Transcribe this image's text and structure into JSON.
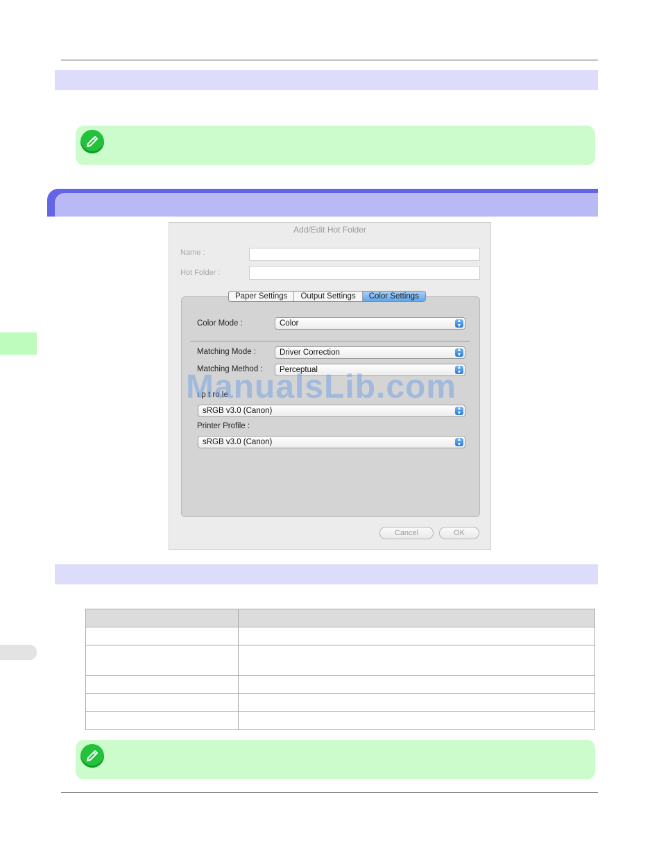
{
  "dialog": {
    "title": "Add/Edit Hot Folder",
    "name_label": "Name :",
    "name_value": "",
    "hot_folder_label": "Hot Folder :",
    "hot_folder_value": "",
    "tabs": [
      {
        "label": "Paper Settings",
        "active": false
      },
      {
        "label": "Output Settings",
        "active": false
      },
      {
        "label": "Color Settings",
        "active": true
      }
    ],
    "color_mode_label": "Color Mode :",
    "color_mode_value": "Color",
    "matching_mode_label": "Matching Mode :",
    "matching_mode_value": "Driver Correction",
    "matching_method_label": "Matching Method :",
    "matching_method_value": "Perceptual",
    "input_profile_label": "ı p t  ro le",
    "input_profile_value": "sRGB v3.0 (Canon)",
    "printer_profile_label": "Printer Profile :",
    "printer_profile_value": "sRGB v3.0 (Canon)",
    "cancel_label": "Cancel",
    "ok_label": "OK"
  },
  "watermark": "ManualsLib.com",
  "colors": {
    "section_band": "#ddddfb",
    "heading_band": "#b9b9f6",
    "heading_edge": "#6464e6",
    "note_bg": "#ccfbcc",
    "note_icon": "#22c23a",
    "tab_active": "#5ea6ec"
  },
  "icons": [
    "pencil-note-icon",
    "popup-arrows-icon"
  ]
}
